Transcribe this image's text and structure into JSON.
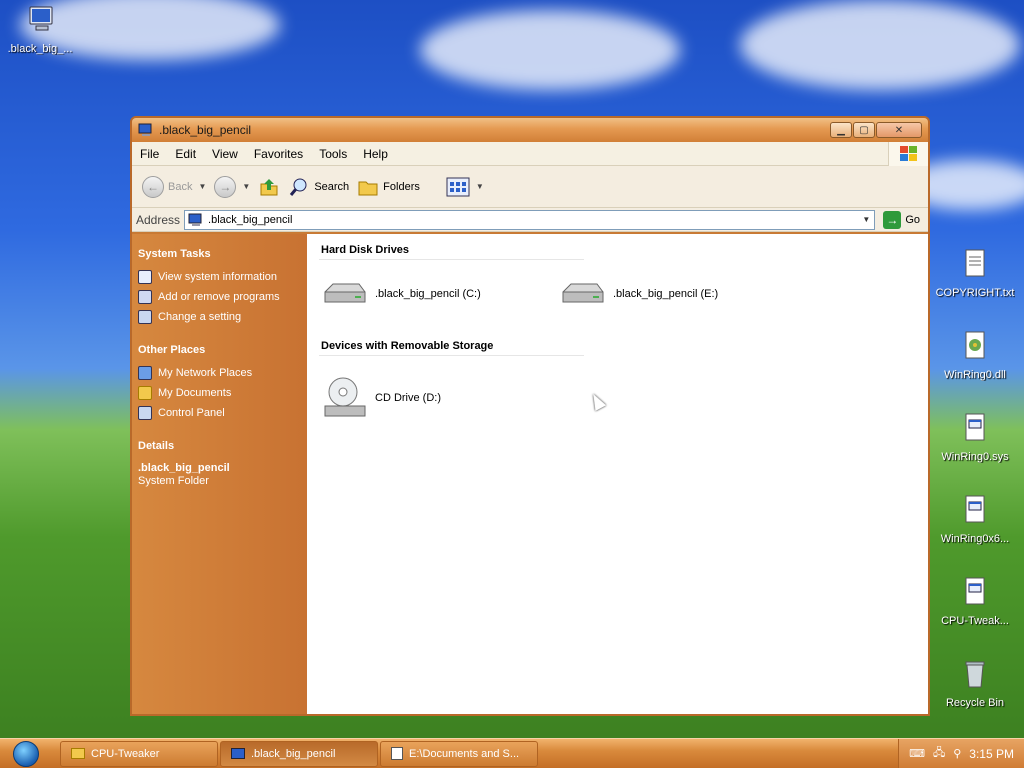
{
  "desktop": {
    "icons_left": [
      {
        "label": ".black_big_...",
        "icon": "computer-icon"
      }
    ],
    "icons_right": [
      {
        "label": "COPYRIGHT.txt",
        "icon": "text-file-icon"
      },
      {
        "label": "WinRing0.dll",
        "icon": "dll-file-icon"
      },
      {
        "label": "WinRing0.sys",
        "icon": "sys-file-icon"
      },
      {
        "label": "WinRing0x6...",
        "icon": "sys-file-icon"
      },
      {
        "label": "CPU-Tweak...",
        "icon": "app-icon"
      },
      {
        "label": "Recycle Bin",
        "icon": "recycle-bin-icon"
      }
    ]
  },
  "window": {
    "title": ".black_big_pencil",
    "menu": [
      "File",
      "Edit",
      "View",
      "Favorites",
      "Tools",
      "Help"
    ],
    "toolbar": {
      "back": "Back",
      "search": "Search",
      "folders": "Folders"
    },
    "address": {
      "label": "Address",
      "value": ".black_big_pencil",
      "go": "Go"
    },
    "taskpane": {
      "system_tasks": {
        "title": "System Tasks",
        "items": [
          "View system information",
          "Add or remove programs",
          "Change a setting"
        ]
      },
      "other_places": {
        "title": "Other Places",
        "items": [
          "My Network Places",
          "My Documents",
          "Control Panel"
        ]
      },
      "details": {
        "title": "Details",
        "name": ".black_big_pencil",
        "type": "System Folder"
      }
    },
    "content": {
      "groups": [
        {
          "title": "Hard Disk Drives",
          "items": [
            ".black_big_pencil (C:)",
            ".black_big_pencil (E:)"
          ]
        },
        {
          "title": "Devices with Removable Storage",
          "items": [
            "CD Drive (D:)"
          ]
        }
      ]
    }
  },
  "taskbar": {
    "tasks": [
      "CPU-Tweaker",
      ".black_big_pencil",
      "E:\\Documents and S..."
    ],
    "clock": "3:15 PM"
  },
  "colors": {
    "accent": "#c87232",
    "title": "#e59a52"
  }
}
